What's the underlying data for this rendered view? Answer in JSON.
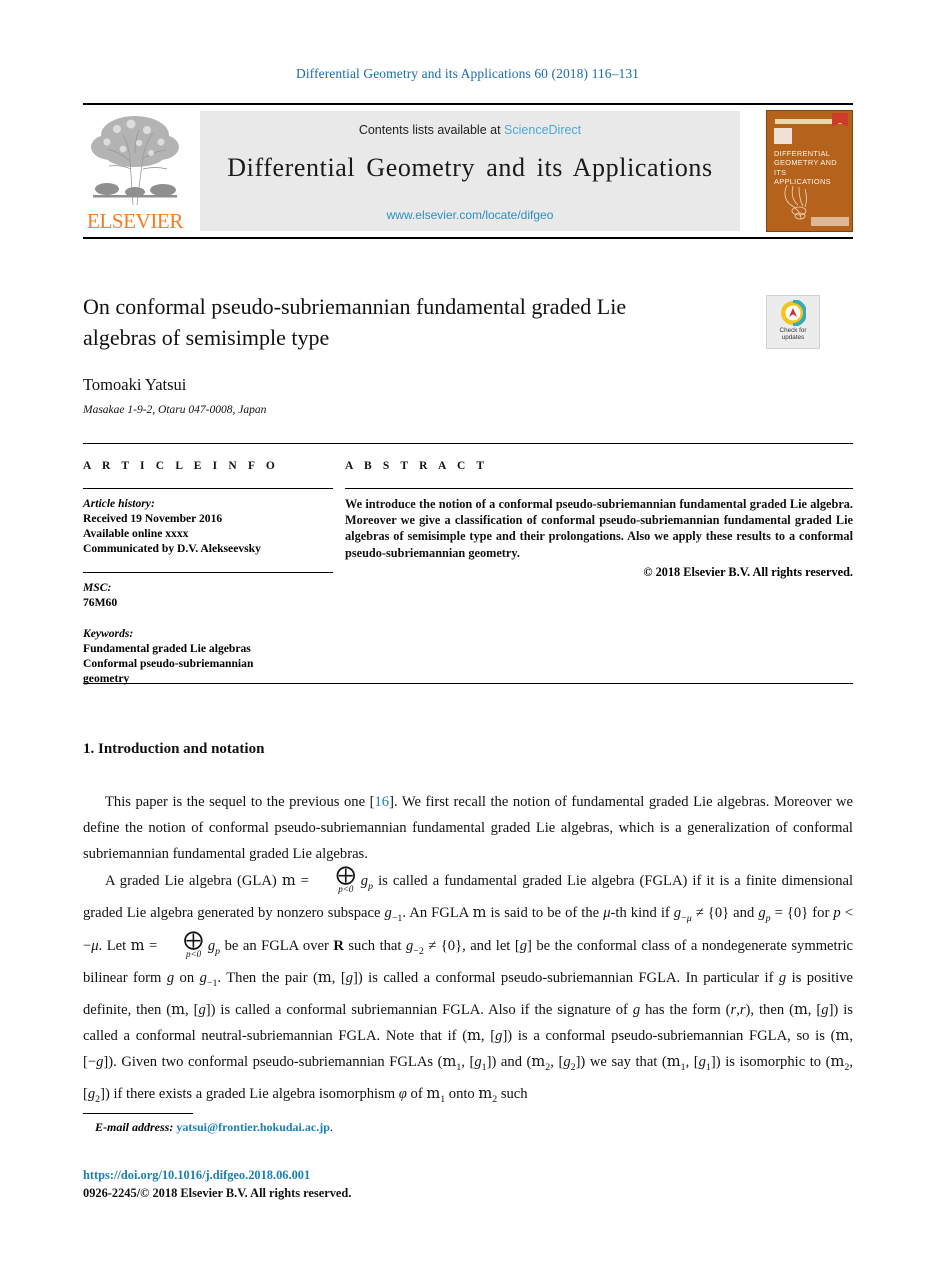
{
  "running_head": "Differential Geometry and its Applications 60 (2018) 116–131",
  "masthead": {
    "publisher_name": "ELSEVIER",
    "publisher_logo_icon": "elsevier-tree-icon",
    "contents_prefix": "Contents lists available at",
    "contents_link": "ScienceDirect",
    "journal_title": "Differential Geometry and its Applications",
    "journal_url": "www.elsevier.com/locate/difgeo",
    "cover": {
      "title_lines": [
        "DIFFERENTIAL",
        "GEOMETRY AND ITS",
        "APPLICATIONS"
      ],
      "publisher_mark": "elsevier-mini-icon",
      "art_icon": "line-art-figure-icon"
    }
  },
  "article": {
    "title": "On conformal pseudo-subriemannian fundamental graded Lie algebras of semisimple type",
    "author": "Tomoaki Yatsui",
    "affiliation": "Masakae 1-9-2, Otaru 047-0008, Japan",
    "crossmark": {
      "icon": "crossmark-icon",
      "line1": "Check for",
      "line2": "updates"
    }
  },
  "article_info": {
    "heading": "A R T I C L E   I N F O",
    "history_label": "Article history:",
    "history": [
      "Received 19 November 2016",
      "Available online xxxx",
      "Communicated by D.V. Alekseevsky"
    ],
    "msc_label": "MSC:",
    "msc": "76M60",
    "keywords_label": "Keywords:",
    "keywords": [
      "Fundamental graded Lie algebras",
      "Conformal pseudo-subriemannian",
      "geometry"
    ]
  },
  "abstract": {
    "heading": "A B S T R A C T",
    "text": "We introduce the notion of a conformal pseudo-subriemannian fundamental graded Lie algebra. Moreover we give a classification of conformal pseudo-subriemannian fundamental graded Lie algebras of semisimple type and their prolongations. Also we apply these results to a conformal pseudo-subriemannian geometry.",
    "copyright": "© 2018 Elsevier B.V. All rights reserved."
  },
  "section": {
    "heading": "1. Introduction and notation",
    "paragraph1_before_cite": "This paper is the sequel to the previous one [",
    "citation": "16",
    "paragraph1_after_cite": "]. We first recall the notion of fundamental graded Lie algebras. Moreover we define the notion of conformal pseudo-subriemannian fundamental graded Lie algebras, which is a generalization of conformal subriemannian fundamental graded Lie algebras."
  },
  "footer": {
    "email_label": "E-mail address:",
    "email": "yatsui@frontier.hokudai.ac.jp",
    "email_period": ".",
    "doi": "https://doi.org/10.1016/j.difgeo.2018.06.001",
    "issn_copyright": "0926-2245/© 2018 Elsevier B.V. All rights reserved."
  },
  "colors": {
    "link_blue": "#1a7fb5",
    "sciencedirect_blue": "#4aa8d8",
    "elsevier_orange": "#f47c20",
    "cover_orange": "#b4621c",
    "masthead_gray": "#e9e9e9"
  }
}
